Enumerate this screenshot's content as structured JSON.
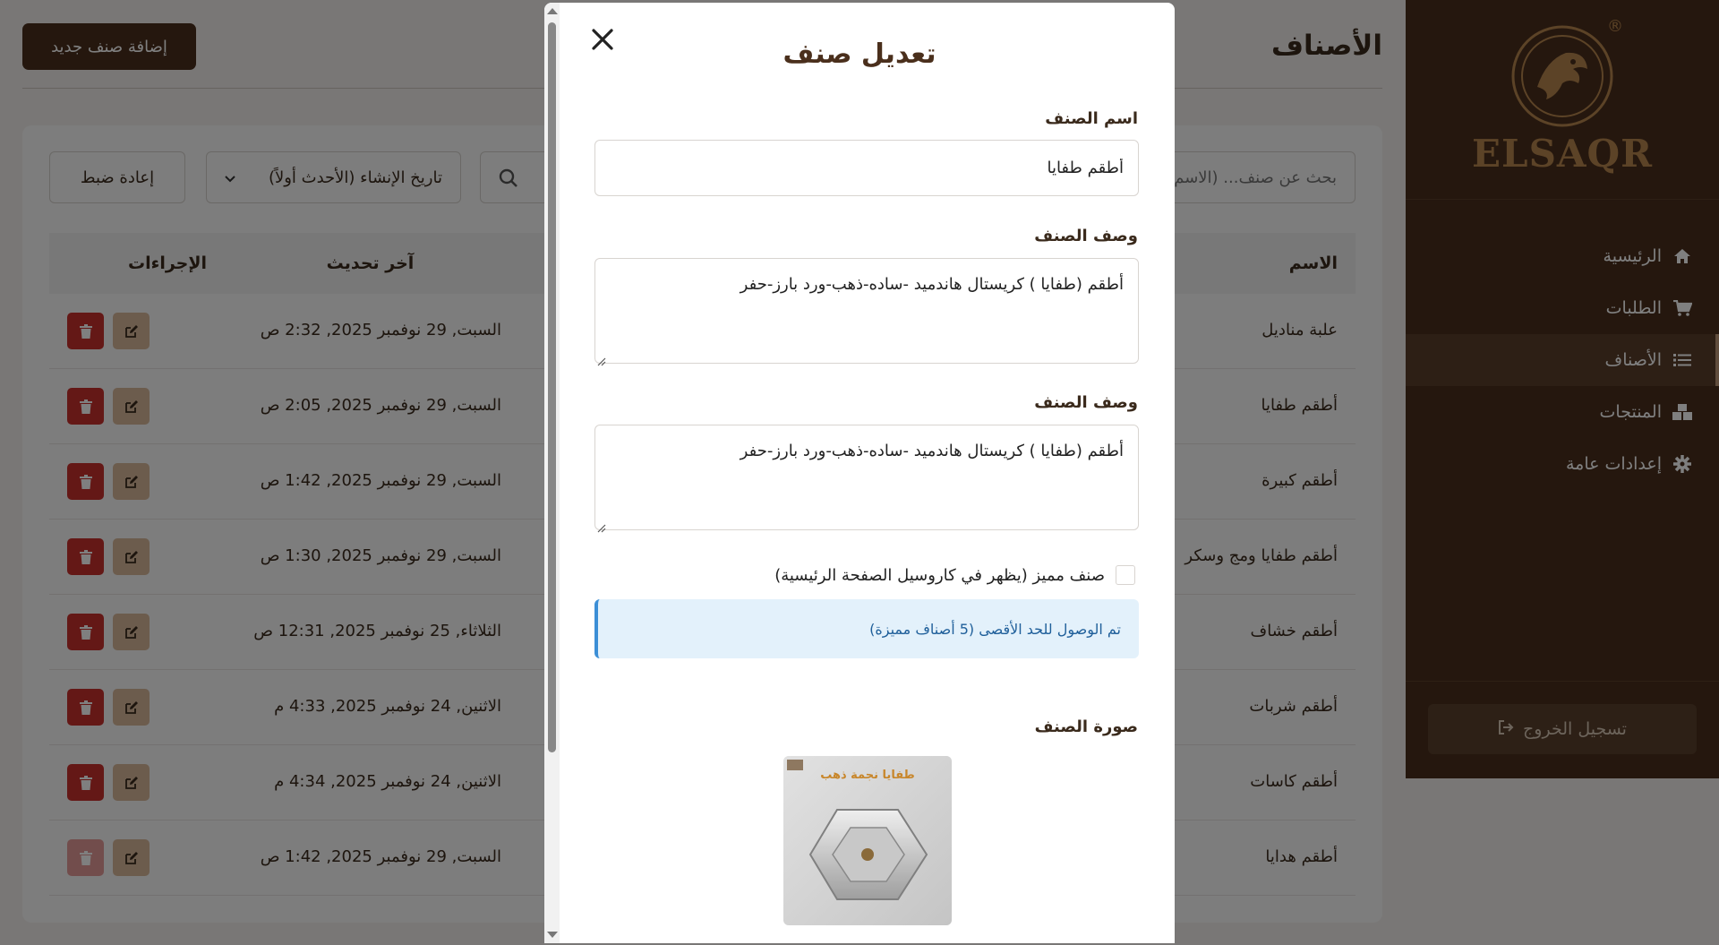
{
  "sidebar": {
    "brand": "ELSAQR",
    "registered_mark": "®",
    "items": [
      {
        "label": "الرئيسية",
        "icon": "home-icon"
      },
      {
        "label": "الطلبات",
        "icon": "cart-icon"
      },
      {
        "label": "الأصناف",
        "icon": "list-icon",
        "active": true
      },
      {
        "label": "المنتجات",
        "icon": "boxes-icon"
      },
      {
        "label": "إعدادات عامة",
        "icon": "gear-icon"
      }
    ],
    "logout_label": "تسجيل الخروج"
  },
  "header": {
    "title": "الأصناف",
    "add_button_label": "إضافة صنف جديد"
  },
  "toolbar": {
    "search_placeholder": "بحث عن صنف... (الاسم)",
    "sort_selected": "تاريخ الإنشاء (الأحدث أولاً)",
    "reset_label": "إعادة ضبط"
  },
  "table": {
    "columns": {
      "name": "الاسم",
      "updated": "آخر تحديث",
      "actions": "الإجراءات"
    },
    "rows": [
      {
        "name": "علبة مناديل",
        "updated": "السبت, 29 نوفمبر 2025, 2:32 ص"
      },
      {
        "name": "أطقم طفايا",
        "updated": "السبت, 29 نوفمبر 2025, 2:05 ص"
      },
      {
        "name": "أطقم كبيرة",
        "updated": "السبت, 29 نوفمبر 2025, 1:42 ص"
      },
      {
        "name": "أطقم طفايا ومج وسكر",
        "updated": "السبت, 29 نوفمبر 2025, 1:30 ص"
      },
      {
        "name": "أطقم خشاف",
        "updated": "الثلاثاء, 25 نوفمبر 2025, 12:31 ص"
      },
      {
        "name": "أطقم شربات",
        "updated": "الاثنين, 24 نوفمبر 2025, 4:33 م"
      },
      {
        "name": "أطقم كاسات",
        "updated": "الاثنين, 24 نوفمبر 2025, 4:34 م"
      },
      {
        "name": "أطقم هدايا",
        "updated": "السبت, 29 نوفمبر 2025, 1:42 ص",
        "delete_disabled": true
      }
    ]
  },
  "modal": {
    "title": "تعديل صنف",
    "name_label": "اسم الصنف",
    "name_value": "أطقم طفايا",
    "desc_label_1": "وصف الصنف",
    "desc_value_1": "أطقم (طفايا ) كريستال هاندميد -ساده-ذهب-ورد بارز-حفر",
    "desc_label_2": "وصف الصنف",
    "desc_value_2": "أطقم (طفايا ) كريستال هاندميد -ساده-ذهب-ورد بارز-حفر",
    "featured_label": "صنف مميز (يظهر في كاروسيل الصفحة الرئيسية)",
    "featured_checked": false,
    "limit_notice": "تم الوصول للحد الأقصى (5 أصناف مميزة)",
    "image_label": "صورة الصنف",
    "image_caption": "طفايا نجمة ذهب"
  },
  "colors": {
    "brand_brown": "#4a2f1c",
    "gold": "#b8864e",
    "danger": "#c8302c",
    "edit": "#d8b89a",
    "info_bg": "#e3f1fb",
    "info_text": "#1f5f9a"
  }
}
